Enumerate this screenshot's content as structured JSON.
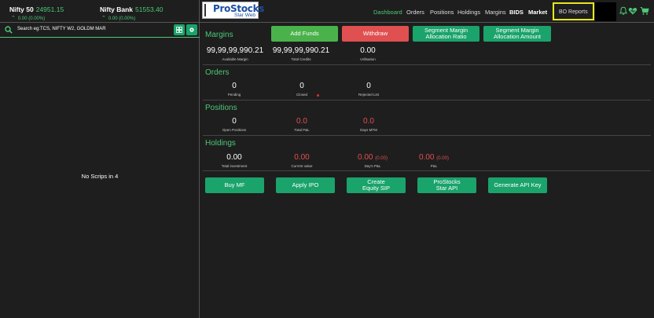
{
  "indices": [
    {
      "name": "Nifty 50",
      "value": "24951.15",
      "change": "0.00 (0.00%)"
    },
    {
      "name": "Nifty Bank",
      "value": "51553.40",
      "change": "0.00 (0.00%)"
    }
  ],
  "watchlist": {
    "search_placeholder": "Search eg:TCS, NIFTY W2, GOLDM MAR",
    "empty_text": "No Scrips in 4"
  },
  "logo": {
    "brand": "ProStocks",
    "sub": "Star Web",
    "mark": "ProStocks"
  },
  "nav": {
    "dashboard": "Dashboard",
    "orders": "Orders",
    "positions": "Positions",
    "holdings": "Holdings",
    "margins": "Margins",
    "bids": "BIDS",
    "market": "Market",
    "bo_reports": "BO Reports"
  },
  "margins": {
    "title": "Margins",
    "add_funds": "Add Funds",
    "withdraw": "Withdraw",
    "seg_ratio": [
      "Segment Margin",
      "Allocation Ratio"
    ],
    "seg_amount": [
      "Segment Margin",
      "Allocation Amount"
    ],
    "available_value": "99,99,99,990.21",
    "available_label": "Available Margin",
    "credits_value": "99,99,99,990.21",
    "credits_label": "Total Credits",
    "utilization_value": "0.00",
    "utilization_label": "Utilisation"
  },
  "orders": {
    "title": "Orders",
    "pending_value": "0",
    "pending_label": "Pending",
    "closed_value": "0",
    "closed_label": "Closed",
    "rejected_value": "0",
    "rejected_label": "Rejected List"
  },
  "positions": {
    "title": "Positions",
    "open_value": "0",
    "open_label": "Open Positions",
    "pnl_value": "0.0",
    "pnl_label": "Total P&L",
    "mtm_value": "0.0",
    "mtm_label": "Days MTM"
  },
  "holdings": {
    "title": "Holdings",
    "investment_value": "0.00",
    "investment_label": "Total investment",
    "current_value": "0.00",
    "current_label": "Current value",
    "days_pnl_value": "0.00",
    "days_pnl_pct": "(0.00)",
    "days_pnl_label": "Day's P&L",
    "pnl_value": "0.00",
    "pnl_pct": "(0.00)",
    "pnl_label": "P&L"
  },
  "actions": {
    "buy_mf": "Buy MF",
    "apply_ipo": "Apply IPO",
    "equity_sip": [
      "Create",
      "Equity SIP"
    ],
    "star_api": [
      "ProStocks",
      "Star API"
    ],
    "api_key": "Generate API Key"
  },
  "colors": {
    "accent": "#4cc877",
    "button_teal": "#1aa36b",
    "button_green": "#4ab24a",
    "button_red": "#e05050",
    "loss": "#e05050",
    "highlight": "#e8e81a"
  },
  "icons": [
    "search-icon",
    "grid-icon",
    "gear-icon",
    "bell-icon",
    "heart-icon",
    "cart-icon",
    "arrow-up-icon"
  ]
}
